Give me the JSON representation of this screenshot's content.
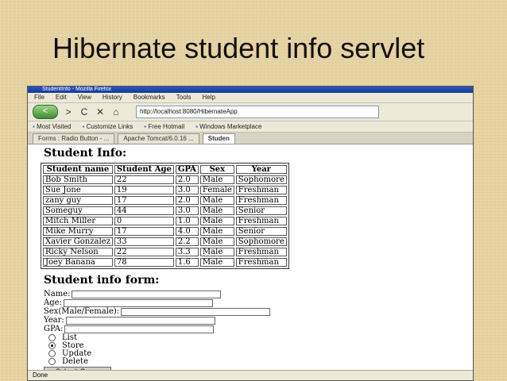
{
  "slide": {
    "title": "Hibernate student info servlet"
  },
  "browser": {
    "window_title": "StudentInfo - Mozilla Firefox",
    "menu": [
      "File",
      "Edit",
      "View",
      "History",
      "Bookmarks",
      "Tools",
      "Help"
    ],
    "nav": {
      "back": "<",
      "forward": ">",
      "reload": "C",
      "stop": "✕",
      "home": "⌂"
    },
    "address": "http://localhost:8080/HibernateApp",
    "bookmarks": [
      "Most Visited",
      "Customize Links",
      "Free Hotmail",
      "Windows Marketplace"
    ],
    "tabs": [
      "Forms : Radio Button - ...",
      "Apache Tomcat/6.0.16 ...",
      "Studen"
    ],
    "status": "Done"
  },
  "page": {
    "info_heading": "Student Info:",
    "columns": [
      "Student name",
      "Student Age",
      "GPA",
      "Sex",
      "Year"
    ],
    "rows": [
      [
        "Bob Smith",
        "22",
        "2.0",
        "Male",
        "Sophomore"
      ],
      [
        "Sue Jone",
        "19",
        "3.0",
        "Female",
        "Freshman"
      ],
      [
        "zany guy",
        "17",
        "2.0",
        "Male",
        "Freshman"
      ],
      [
        "Someguy",
        "44",
        "3.0",
        "Male",
        "Senior"
      ],
      [
        "Mitch Miller",
        "0",
        "1.0",
        "Male",
        "Freshman"
      ],
      [
        "Mike Murry",
        "17",
        "4.0",
        "Male",
        "Senior"
      ],
      [
        "Xavier Gonzalez",
        "33",
        "2.2",
        "Male",
        "Sophomore"
      ],
      [
        "Ricky Nelson",
        "22",
        "3.3",
        "Male",
        "Freshman"
      ],
      [
        "Joey Banana",
        "78",
        "1.6",
        "Male",
        "Freshman"
      ]
    ],
    "form_heading": "Student info form:",
    "fields": {
      "name_label": "Name:",
      "age_label": "Age:",
      "sex_label": "Sex(Male/Female):",
      "year_label": "Year:",
      "gpa_label": "GPA:"
    },
    "radios": [
      {
        "label": "List",
        "checked": false
      },
      {
        "label": "Store",
        "checked": true
      },
      {
        "label": "Update",
        "checked": false
      },
      {
        "label": "Delete",
        "checked": false
      }
    ],
    "submit_label": "Submit Query"
  }
}
